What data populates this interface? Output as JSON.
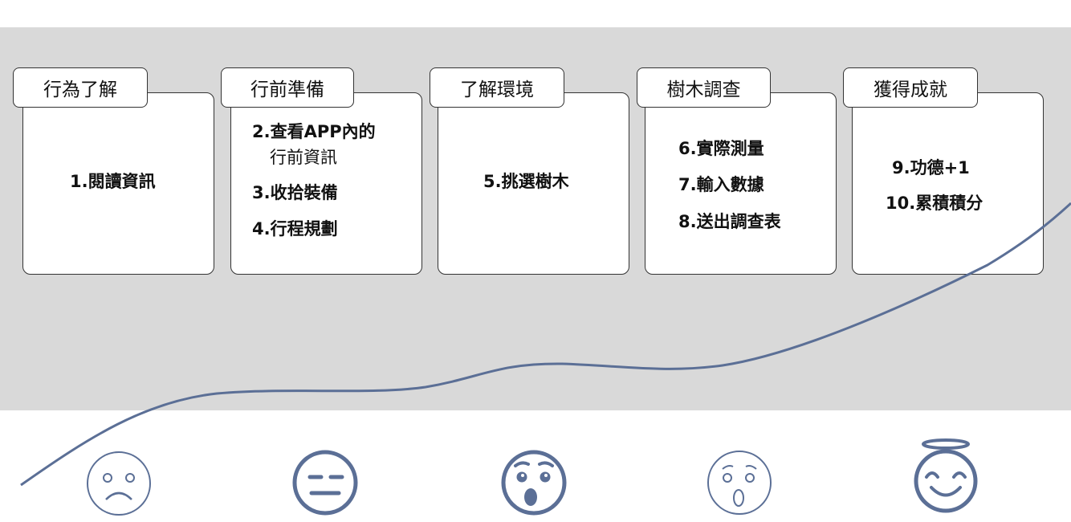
{
  "colors": {
    "band": "#d9d9d9",
    "curve": "#5b6f96",
    "face": "#5b6f96"
  },
  "stages": [
    {
      "title": "行為了解",
      "steps": [
        {
          "text": "1.閱讀資訊"
        }
      ]
    },
    {
      "title": "行前準備",
      "steps": [
        {
          "text": "2.查看APP內的"
        },
        {
          "text": "行前資訊"
        },
        {
          "text": "3.收拾裝備"
        },
        {
          "text": "4.行程規劃"
        }
      ]
    },
    {
      "title": "了解環境",
      "steps": [
        {
          "text": "5.挑選樹木"
        }
      ]
    },
    {
      "title": "樹木調查",
      "steps": [
        {
          "text": "6.實際測量"
        },
        {
          "text": "7.輸入數據"
        },
        {
          "text": "8.送出調查表"
        }
      ]
    },
    {
      "title": "獲得成就",
      "steps": [
        {
          "text": "9.功德+1"
        },
        {
          "text": "10.累積積分"
        }
      ]
    }
  ],
  "emotions": [
    {
      "icon": "sad-face-icon"
    },
    {
      "icon": "neutral-face-icon"
    },
    {
      "icon": "surprised-face-icon"
    },
    {
      "icon": "worried-face-icon"
    },
    {
      "icon": "angel-smile-face-icon"
    }
  ]
}
